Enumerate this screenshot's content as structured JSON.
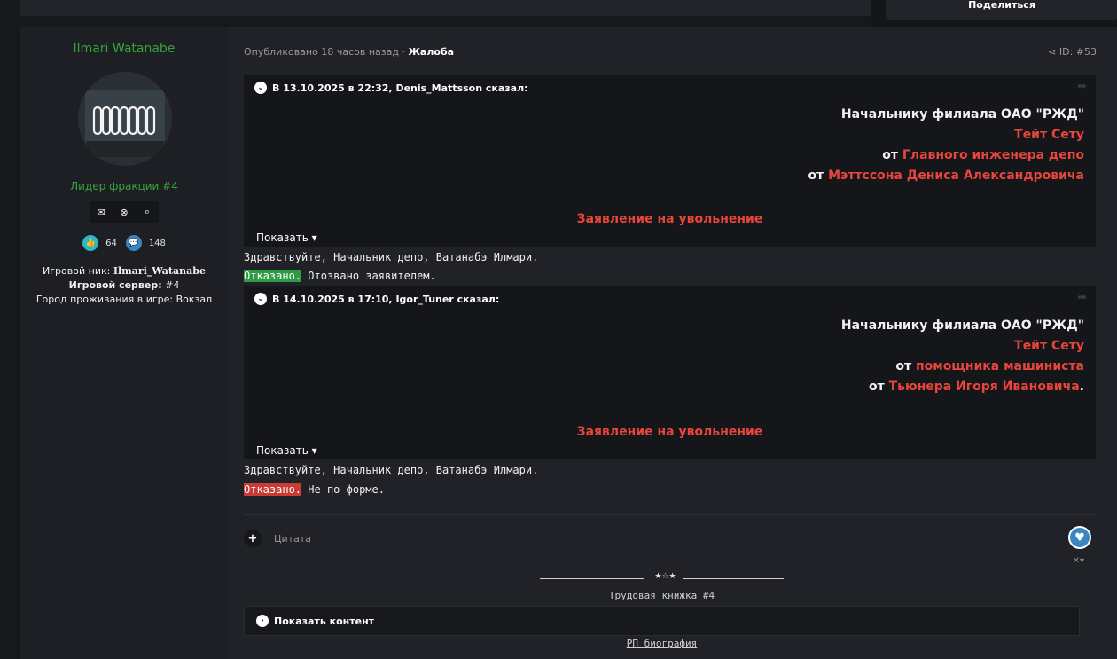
{
  "share_popup": {
    "label": "Поделиться"
  },
  "author": {
    "name": "Ilmari Watanabe",
    "rank": "Лидер фракции #4",
    "likes": "64",
    "posts": "148",
    "nick_label": "Игровой ник:",
    "nick_value": "Ilmari_Watanabe",
    "server_label": "Игровой сервер:",
    "server_value": "#4",
    "city_label": "Город проживания в игре:",
    "city_value": "Вокзал"
  },
  "post": {
    "published": "Опубликовано 18 часов назад ·",
    "report": "Жалоба",
    "id": "ID: #53"
  },
  "quote1": {
    "header": "В 13.10.2025 в 22:32, Denis_Mattsson сказал:",
    "line1": "Начальнику филиала ОАО \"РЖД\"",
    "line2": "Тейт Сету",
    "line3_prefix": "от",
    "line3": "Главного инженера депо",
    "line4_prefix": "от",
    "line4": "Мэттссона Дениса Александровича",
    "title": "Заявление на увольнение",
    "show": "Показать"
  },
  "reply1": {
    "greeting": "Здравствуйте, Начальник депо, Ватанабэ Илмари.",
    "status": "Отказано.",
    "reason": "Отозвано заявителем."
  },
  "quote2": {
    "header": "В 14.10.2025 в 17:10, Igor_Tuner сказал:",
    "line1": "Начальнику филиала ОАО \"РЖД\"",
    "line2": "Тейт Сету",
    "line3_prefix": "от",
    "line3": "помощника машиниста",
    "line4_prefix": "от",
    "line4": "Тьюнера Игоря Ивановича",
    "line4_suffix": ".",
    "title": "Заявление на увольнение",
    "show": "Показать"
  },
  "reply2": {
    "greeting": "Здравствуйте, Начальник депо, Ватанабэ Илмари.",
    "status": "Отказано.",
    "reason": "Не по форме."
  },
  "actions": {
    "quote": "Цитата"
  },
  "signature": {
    "stars": "★☆★",
    "title": "Трудовая книжка #4",
    "spoiler": "Показать контент",
    "bio": "РП биография"
  },
  "colors": {
    "accent_green": "#3aa33a",
    "red": "#e8453c",
    "approve_bg": "#2e9b45",
    "deny_bg": "#c93b34",
    "like_blue": "#2fb5c8",
    "heart_blue": "#3a85c2"
  }
}
